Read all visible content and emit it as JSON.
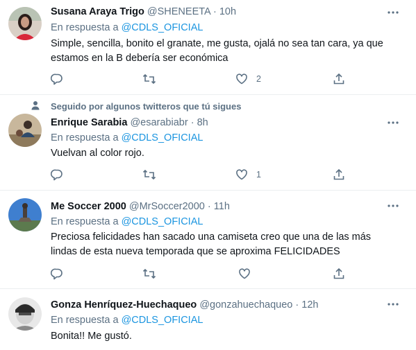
{
  "tweets": [
    {
      "name": "Susana Araya Trigo",
      "handle": "@SHENEETA",
      "time": "10h",
      "reply_prefix": "En respuesta a",
      "reply_to": "@CDLS_OFICIAL",
      "text": "Simple, sencilla, bonito el granate, me gusta, ojalá no sea tan cara, ya que estamos en la B debería ser económica",
      "likes": "2"
    },
    {
      "social_context": "Seguido por algunos twitteros que tú sigues",
      "name": "Enrique Sarabia",
      "handle": "@esarabiabr",
      "time": "8h",
      "reply_prefix": "En respuesta a",
      "reply_to": "@CDLS_OFICIAL",
      "text": "Vuelvan al color rojo.",
      "likes": "1"
    },
    {
      "name": "Me Soccer 2000",
      "handle": "@MrSoccer2000",
      "time": "11h",
      "reply_prefix": "En respuesta a",
      "reply_to": "@CDLS_OFICIAL",
      "text": "Preciosa felicidades han sacado una camiseta creo que una de las más lindas de esta nueva temporada que se aproxima FELICIDADES",
      "likes": ""
    },
    {
      "name": "Gonza Henríquez-Huechaqueo",
      "handle": "@gonzahuechaqueo",
      "time": "12h",
      "reply_prefix": "En respuesta a",
      "reply_to": "@CDLS_OFICIAL",
      "text": "Bonita!! Me gustó.",
      "likes": ""
    }
  ],
  "icons": {
    "reply": "reply-icon",
    "retweet": "retweet-icon",
    "like": "heart-icon",
    "share": "share-icon",
    "more": "more-icon",
    "social": "person-icon"
  },
  "colors": {
    "text": "#0f1419",
    "secondary": "#5b7083",
    "link": "#1b95e0",
    "border": "#ebeef0"
  }
}
